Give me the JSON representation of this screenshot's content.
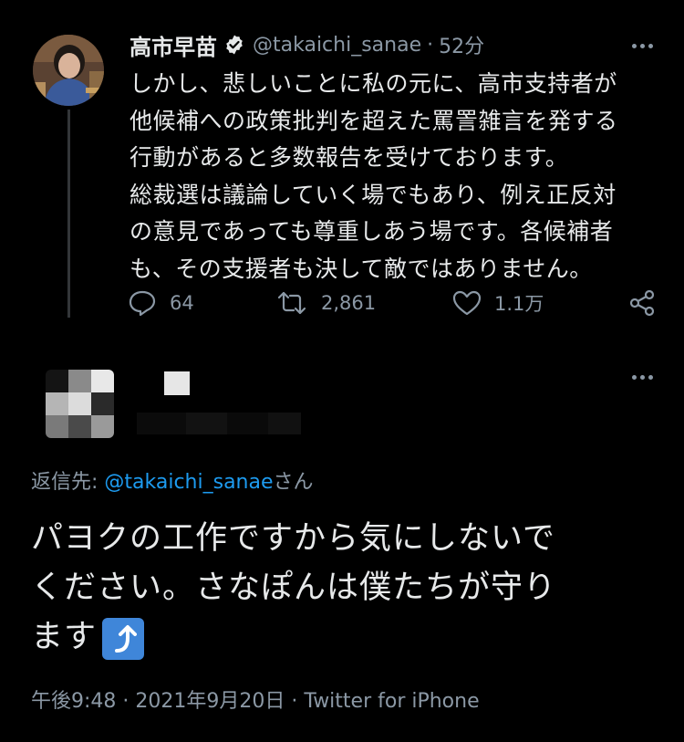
{
  "tweet": {
    "author_name": "高市早苗",
    "handle": "@takaichi_sanae",
    "separator": "·",
    "time_ago": "52分",
    "body_lines": [
      "しかし、悲しいことに私の元に、高市支持者が",
      "他候補への政策批判を超えた罵詈雑言を発する",
      "行動があると多数報告を受けております。",
      "総裁選は議論していく場でもあり、例え正反対",
      "の意見であっても尊重しあう場です。各候補者",
      "も、その支援者も決して敵ではありません。"
    ],
    "reply_count": "64",
    "retweet_count": "2,861",
    "like_count": "1.1万"
  },
  "reply": {
    "reply_to_label": "返信先: ",
    "reply_to_handle": "@takaichi_sanae",
    "reply_to_suffix": "さん",
    "text_lines": [
      "パヨクの工作ですから気にしないで",
      "ください。さなぽんは僕たちが守り",
      "ます"
    ],
    "emoji": "right-arrow-curving-up-icon",
    "timestamp": "午後9:48",
    "date": "2021年9月20日",
    "sep": "·",
    "source": "Twitter for iPhone"
  },
  "colors": {
    "background": "#000000",
    "text": "#e7e9ea",
    "secondary": "#8b98a5",
    "link": "#1d9bf0",
    "emoji_bg": "#3f86d9"
  }
}
